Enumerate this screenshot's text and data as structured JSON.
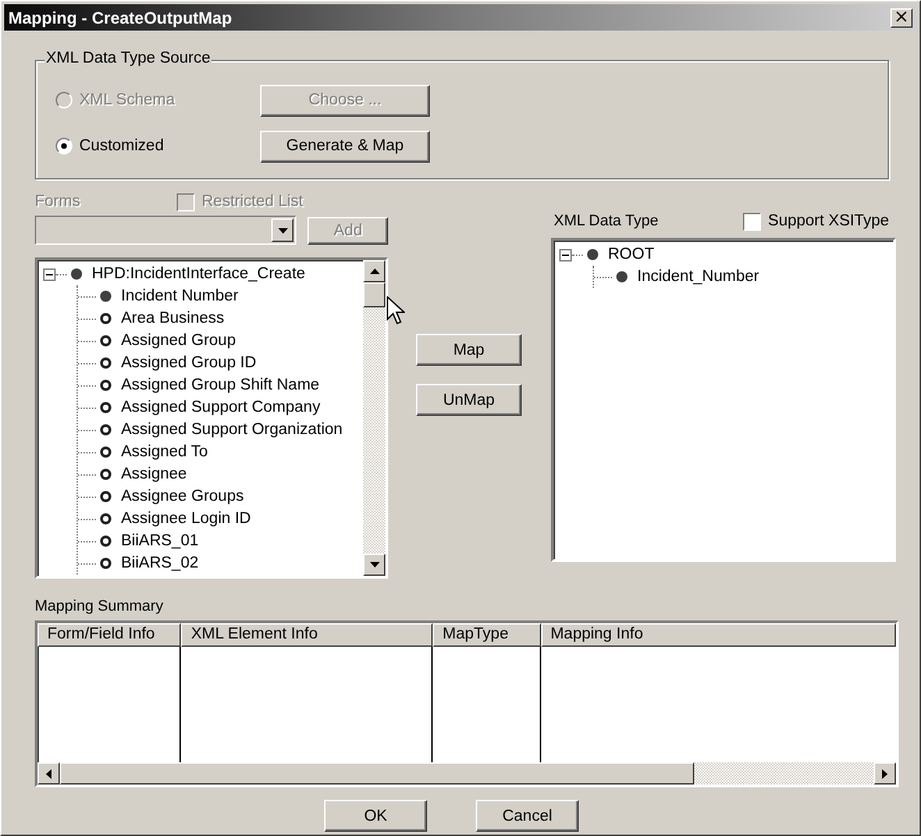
{
  "window": {
    "title": "Mapping - CreateOutputMap",
    "close": "×"
  },
  "source_group": {
    "title": "XML Data Type Source",
    "options": [
      {
        "label": "XML Schema",
        "selected": false,
        "disabled": true,
        "button": {
          "label": "Choose ...",
          "disabled": true
        }
      },
      {
        "label": "Customized",
        "selected": true,
        "disabled": false,
        "button": {
          "label": "Generate & Map",
          "disabled": false
        }
      }
    ]
  },
  "forms": {
    "label": "Forms",
    "disabled": true,
    "restricted_list": {
      "label": "Restricted List",
      "checked": false,
      "disabled": true
    },
    "add_button": {
      "label": "Add",
      "disabled": true
    }
  },
  "form_tree": {
    "root": {
      "label": "HPD:IncidentInterface_Create",
      "expanded": true,
      "mapped": true,
      "children": [
        {
          "label": "Incident Number",
          "mapped": true
        },
        {
          "label": "Area Business",
          "mapped": false
        },
        {
          "label": "Assigned Group",
          "mapped": false
        },
        {
          "label": "Assigned Group ID",
          "mapped": false
        },
        {
          "label": "Assigned Group Shift Name",
          "mapped": false
        },
        {
          "label": "Assigned Support Company",
          "mapped": false
        },
        {
          "label": "Assigned Support Organization",
          "mapped": false
        },
        {
          "label": "Assigned To",
          "mapped": false
        },
        {
          "label": "Assignee",
          "mapped": false
        },
        {
          "label": "Assignee Groups",
          "mapped": false
        },
        {
          "label": "Assignee Login ID",
          "mapped": false
        },
        {
          "label": "BiiARS_01",
          "mapped": false
        },
        {
          "label": "BiiARS_02",
          "mapped": false
        }
      ]
    }
  },
  "map_buttons": [
    "Map",
    "UnMap"
  ],
  "xml_tree": {
    "label": "XML Data Type",
    "support_xsi_type": {
      "label": "Support XSIType",
      "checked": false
    },
    "root": {
      "label": "ROOT",
      "expanded": true,
      "mapped": true,
      "children": [
        {
          "label": "Incident_Number",
          "mapped": true
        }
      ]
    }
  },
  "mapping_summary": {
    "label": "Mapping Summary",
    "columns": [
      "Form/Field Info",
      "XML Element Info",
      "MapType",
      "Mapping Info"
    ]
  },
  "buttons": [
    "OK",
    "Cancel"
  ]
}
